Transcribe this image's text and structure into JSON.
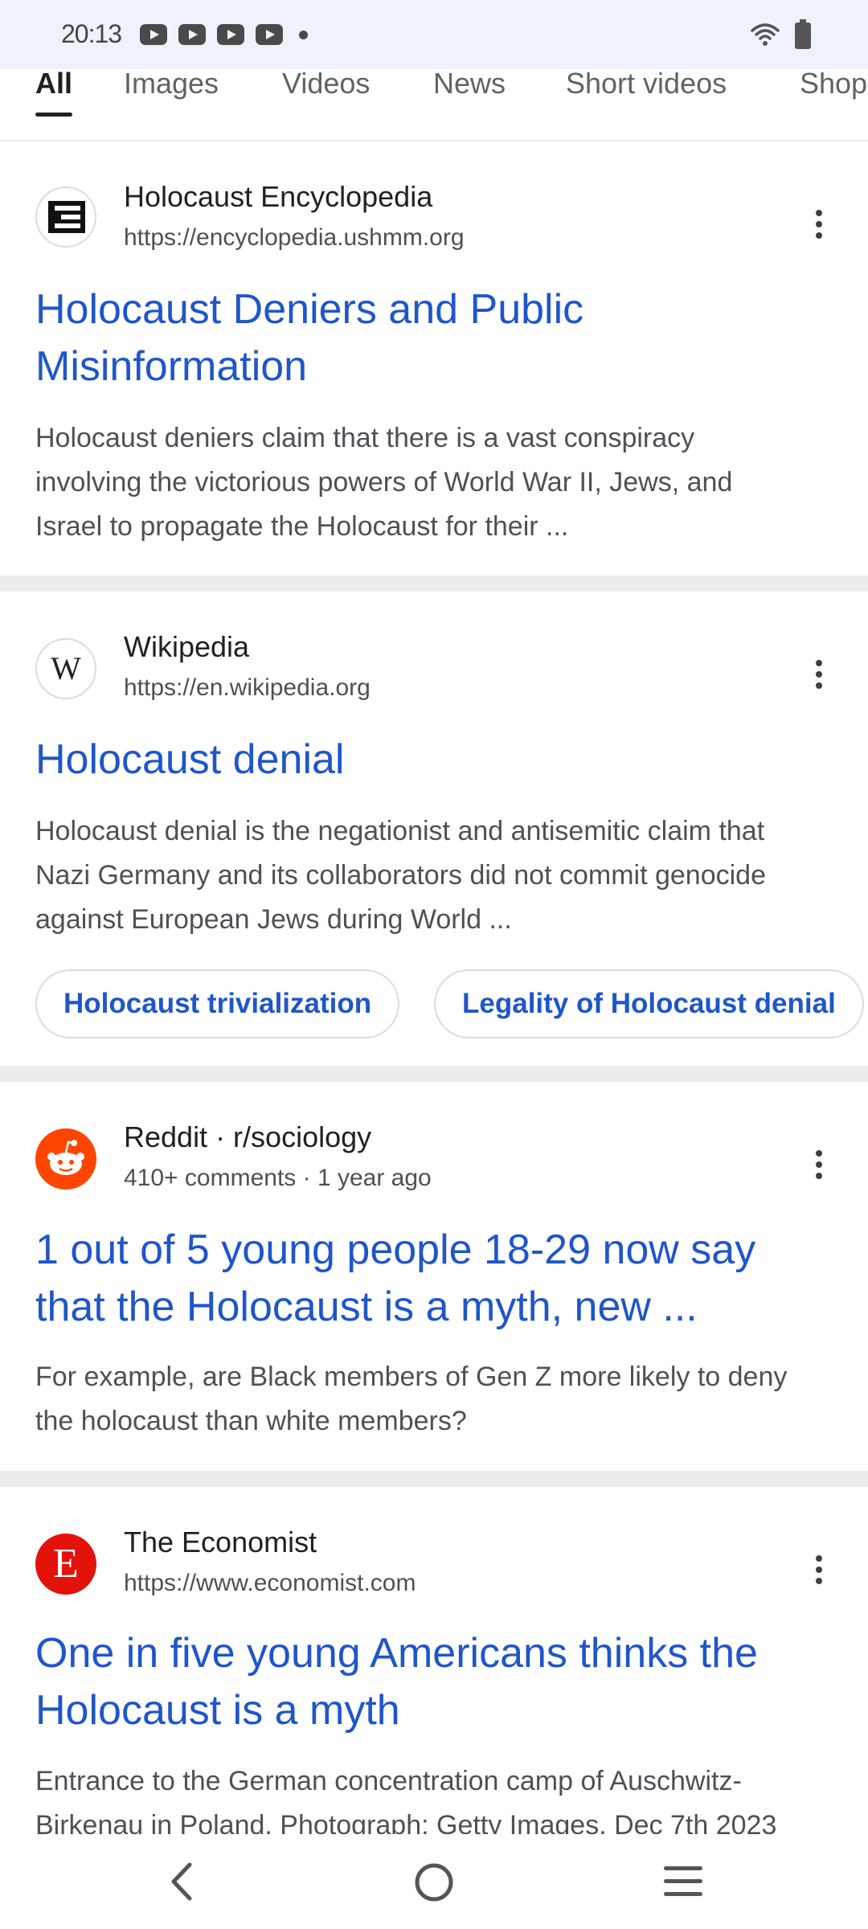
{
  "status_bar": {
    "time": "20:13",
    "icons": [
      "youtube-icon",
      "youtube-icon",
      "youtube-icon",
      "youtube-icon",
      "dot-icon",
      "wifi-icon",
      "battery-icon"
    ]
  },
  "tabs": [
    {
      "label": "All",
      "active": true
    },
    {
      "label": "Images",
      "active": false
    },
    {
      "label": "Videos",
      "active": false
    },
    {
      "label": "News",
      "active": false
    },
    {
      "label": "Short videos",
      "active": false
    },
    {
      "label": "Shop",
      "active": false
    }
  ],
  "results": [
    {
      "site": "Holocaust Encyclopedia",
      "url": "https://encyclopedia.ushmm.org",
      "title_lines": [
        "Holocaust Deniers and Public",
        "Misinformation"
      ],
      "snippet_lines": [
        "Holocaust deniers claim that there is a vast conspiracy",
        "involving the victorious powers of World War II, Jews, and",
        "Israel to propagate the Holocaust for their ..."
      ]
    },
    {
      "site": "Wikipedia",
      "url": "https://en.wikipedia.org",
      "title_lines": [
        "Holocaust denial"
      ],
      "snippet_lines": [
        "Holocaust denial is the negationist and antisemitic claim that",
        "Nazi Germany and its collaborators did not commit genocide",
        "against European Jews during World ..."
      ],
      "chips": [
        "Holocaust trivialization",
        "Legality of Holocaust denial"
      ]
    },
    {
      "site": "Reddit · r/sociology",
      "url": "410+ comments · 1 year ago",
      "title_lines": [
        "1 out of 5 young people 18-29 now say",
        "that the Holocaust is a myth, new ..."
      ],
      "snippet_lines": [
        "For example, are Black members of Gen Z more likely to deny",
        "the holocaust than white members?"
      ]
    },
    {
      "site": "The Economist",
      "url": "https://www.economist.com",
      "title_lines": [
        "One in five young Americans thinks the",
        "Holocaust is a myth"
      ],
      "snippet_lines": [
        "Entrance to the German concentration camp of Auschwitz-",
        "Birkenau in Poland. Photograph: Getty Images. Dec 7th 2023"
      ]
    }
  ],
  "favicons": {
    "wikipedia_letter": "W",
    "economist_letter": "E"
  },
  "colors": {
    "link": "#1f56c9",
    "separator": "#ecedef",
    "status_bar_bg": "#eef2fb",
    "economist_red": "#e3120b",
    "reddit_orange": "#ff4500"
  }
}
